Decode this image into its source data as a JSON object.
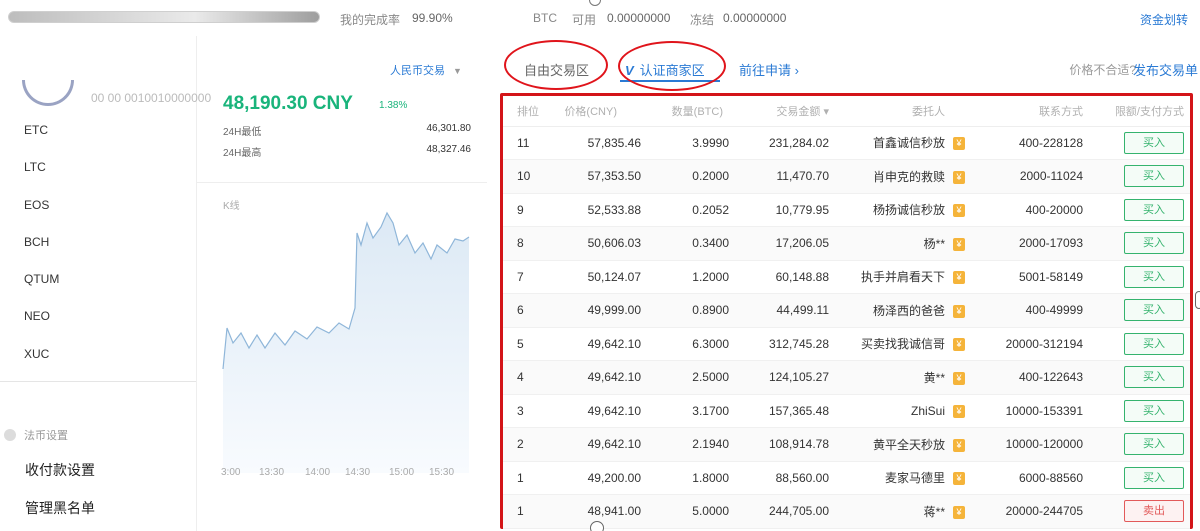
{
  "topbar": {
    "completion_label": "我的完成率",
    "completion_value": "99.90%",
    "progress_fill": 0.999,
    "btc_label": "BTC",
    "available_label": "可用",
    "available_value": "0.00000000",
    "frozen_label": "冻结",
    "frozen_value": "0.00000000",
    "fund_password_link": "资金划转"
  },
  "left": {
    "coins": [
      "ETC",
      "LTC",
      "EOS",
      "BCH",
      "QTUM",
      "NEO",
      "XUC"
    ],
    "fiat_section_title": "法币设置",
    "links": [
      "收付款设置",
      "管理黑名单"
    ]
  },
  "market": {
    "currency_select": "人民币交易",
    "blurred_name": "00 00 0010010000000",
    "price": "48,190.30 CNY",
    "change_pct": "1.38%",
    "high_label": "24H最低",
    "high_value": "46,301.80",
    "low_label": "24H最高",
    "low_value": "48,327.46",
    "chart_label": "K线",
    "time_ticks": [
      "3:00",
      "13:30",
      "14:00",
      "14:30",
      "15:00",
      "15:30"
    ],
    "colors": {
      "up": "#19b47b",
      "line": "#8fb6d9"
    }
  },
  "tabs": {
    "free_trade": "自由交易区",
    "certified": "认证商家区",
    "certified_icon": "V",
    "apply": "前往申请",
    "apply_arrow": "›",
    "price_fit_question": "价格不合适?",
    "post_ad": "发布交易单"
  },
  "table": {
    "headers": [
      "排位",
      "价格(CNY)",
      "数量(BTC)",
      "交易金额",
      "委托人",
      "联系方式",
      "限额/支付方式"
    ],
    "total_sort_icon": "▾",
    "badge_glyph": "¥",
    "rows": [
      {
        "rank": "11",
        "price": "57,835.46",
        "amount": "3.9990",
        "total": "231,284.02",
        "merchant": "首鑫诚信秒放",
        "phone": "400-228128",
        "action": "买入",
        "type": "buy"
      },
      {
        "rank": "10",
        "price": "57,353.50",
        "amount": "0.2000",
        "total": "11,470.70",
        "merchant": "肖申克的救赎",
        "phone": "2000-11024",
        "action": "买入",
        "type": "buy"
      },
      {
        "rank": "9",
        "price": "52,533.88",
        "amount": "0.2052",
        "total": "10,779.95",
        "merchant": "杨扬诚信秒放",
        "phone": "400-20000",
        "action": "买入",
        "type": "buy"
      },
      {
        "rank": "8",
        "price": "50,606.03",
        "amount": "0.3400",
        "total": "17,206.05",
        "merchant": "杨**",
        "phone": "2000-17093",
        "action": "买入",
        "type": "buy"
      },
      {
        "rank": "7",
        "price": "50,124.07",
        "amount": "1.2000",
        "total": "60,148.88",
        "merchant": "执手并肩看天下",
        "phone": "5001-58149",
        "action": "买入",
        "type": "buy"
      },
      {
        "rank": "6",
        "price": "49,999.00",
        "amount": "0.8900",
        "total": "44,499.11",
        "merchant": "杨泽西的爸爸",
        "phone": "400-49999",
        "action": "买入",
        "type": "buy"
      },
      {
        "rank": "5",
        "price": "49,642.10",
        "amount": "6.3000",
        "total": "312,745.28",
        "merchant": "买卖找我诚信哥",
        "phone": "20000-312194",
        "action": "买入",
        "type": "buy"
      },
      {
        "rank": "4",
        "price": "49,642.10",
        "amount": "2.5000",
        "total": "124,105.27",
        "merchant": "黄**",
        "phone": "400-122643",
        "action": "买入",
        "type": "buy"
      },
      {
        "rank": "3",
        "price": "49,642.10",
        "amount": "3.1700",
        "total": "157,365.48",
        "merchant": "ZhiSui",
        "phone": "10000-153391",
        "action": "买入",
        "type": "buy"
      },
      {
        "rank": "2",
        "price": "49,642.10",
        "amount": "2.1940",
        "total": "108,914.78",
        "merchant": "黄平全天秒放",
        "phone": "10000-120000",
        "action": "买入",
        "type": "buy"
      },
      {
        "rank": "1",
        "price": "49,200.00",
        "amount": "1.8000",
        "total": "88,560.00",
        "merchant": "麦家马德里",
        "phone": "6000-88560",
        "action": "买入",
        "type": "buy"
      },
      {
        "rank": "1",
        "price": "48,941.00",
        "amount": "5.0000",
        "total": "244,705.00",
        "merchant": "蒋**",
        "phone": "20000-244705",
        "action": "卖出",
        "type": "sell"
      }
    ]
  }
}
